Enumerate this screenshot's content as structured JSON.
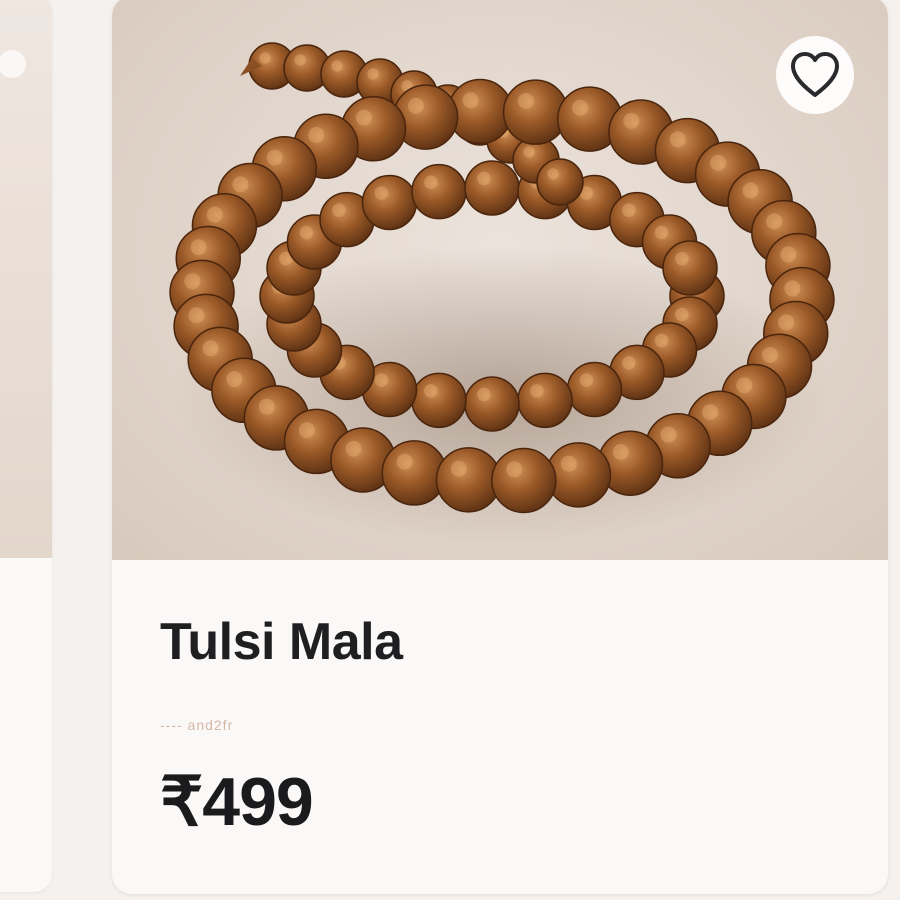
{
  "product": {
    "title": "Tulsi Mala",
    "subtitle": "---- and2fr",
    "price": "₹499",
    "image_icon": "rudraksha-bead-necklace",
    "wishlist_icon": "heart-outline-icon"
  },
  "colors": {
    "bead_dark": "#6b3a18",
    "bead_mid": "#9b5a28",
    "bead_light": "#c8844a",
    "background": "#e6dcd3",
    "price_text": "#1b1b1e"
  }
}
